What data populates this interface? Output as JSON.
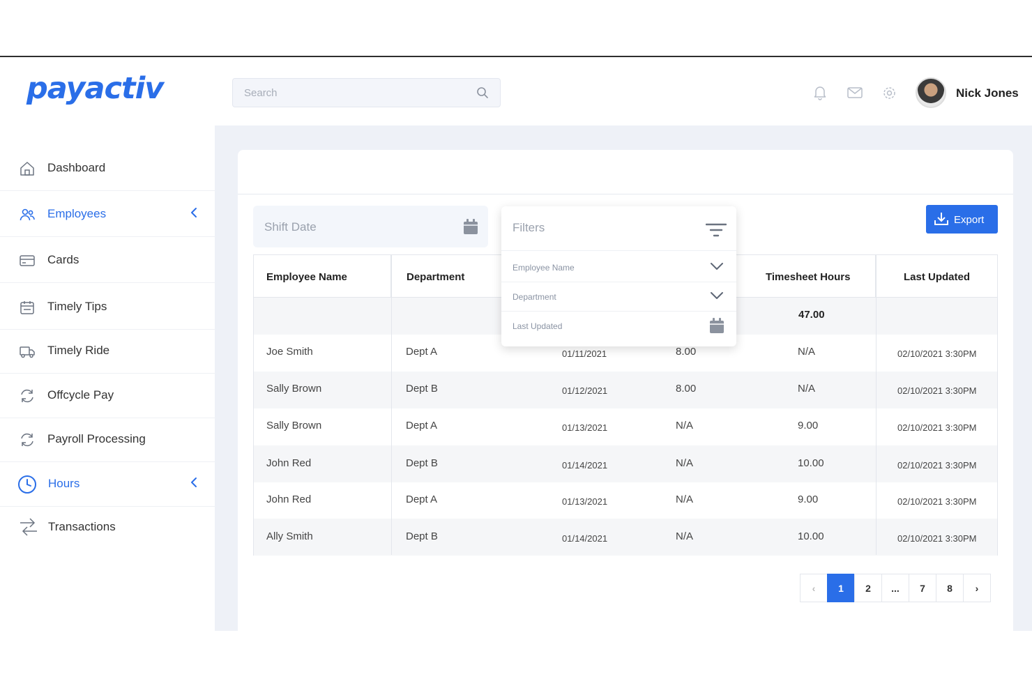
{
  "brand": {
    "logo_text": "payactiv",
    "accent": "#2a6ee8"
  },
  "header": {
    "search_placeholder": "Search",
    "user_name": "Nick Jones",
    "icons": [
      "bell-icon",
      "mail-icon",
      "gear-icon"
    ]
  },
  "sidebar": {
    "items": [
      {
        "label": "Dashboard",
        "icon": "home-icon",
        "active": false
      },
      {
        "label": "Employees",
        "icon": "users-icon",
        "active": true
      },
      {
        "label": "Cards",
        "icon": "card-icon",
        "active": false
      },
      {
        "label": "Timely Tips",
        "icon": "calendar-icon",
        "active": false
      },
      {
        "label": "Timely Ride",
        "icon": "truck-icon",
        "active": false
      },
      {
        "label": "Offcycle Pay",
        "icon": "refresh-icon",
        "active": false
      },
      {
        "label": "Payroll Processing",
        "icon": "refresh-icon",
        "active": false
      },
      {
        "label": "Hours",
        "icon": "clock-icon",
        "active": true
      },
      {
        "label": "Transactions",
        "icon": "transfer-icon",
        "active": false
      }
    ]
  },
  "toolbar": {
    "shift_date_label": "Shift Date",
    "export_label": "Export"
  },
  "filters": {
    "title": "Filters",
    "rows": [
      {
        "label": "Employee Name",
        "icon": "chevron-down-icon"
      },
      {
        "label": "Department",
        "icon": "chevron-down-icon"
      },
      {
        "label": "Last Updated",
        "icon": "calendar-icon"
      }
    ]
  },
  "table": {
    "headers": [
      "Employee Name",
      "Department",
      "Timesheet Hours",
      "Last Updated"
    ],
    "total_row": {
      "timesheet_hours": "47.00"
    },
    "rows": [
      {
        "name": "Joe Smith",
        "dept": "Dept A",
        "date": "01/11/2021",
        "hours": "8.00",
        "timesheet": "N/A",
        "updated": "02/10/2021 3:30PM"
      },
      {
        "name": "Sally Brown",
        "dept": "Dept B",
        "date": "01/12/2021",
        "hours": "8.00",
        "timesheet": "N/A",
        "updated": "02/10/2021 3:30PM"
      },
      {
        "name": "Sally Brown",
        "dept": "Dept A",
        "date": "01/13/2021",
        "hours": "N/A",
        "timesheet": "9.00",
        "updated": "02/10/2021 3:30PM"
      },
      {
        "name": "John Red",
        "dept": "Dept B",
        "date": "01/14/2021",
        "hours": "N/A",
        "timesheet": "10.00",
        "updated": "02/10/2021 3:30PM"
      },
      {
        "name": "John Red",
        "dept": "Dept A",
        "date": "01/13/2021",
        "hours": "N/A",
        "timesheet": "9.00",
        "updated": "02/10/2021 3:30PM"
      },
      {
        "name": "Ally Smith",
        "dept": "Dept B",
        "date": "01/14/2021",
        "hours": "N/A",
        "timesheet": "10.00",
        "updated": "02/10/2021 3:30PM"
      }
    ]
  },
  "pagination": {
    "prev": "‹",
    "pages": [
      "1",
      "2",
      "...",
      "7",
      "8"
    ],
    "next": "›",
    "current": "1"
  }
}
